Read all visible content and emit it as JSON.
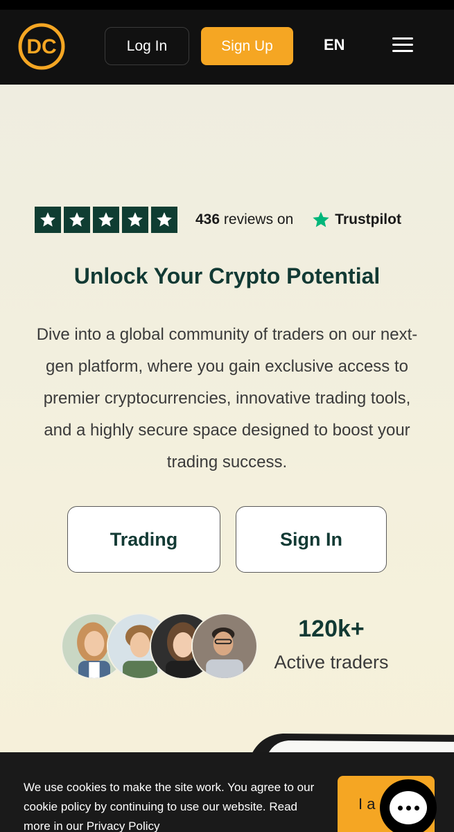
{
  "header": {
    "logo_text": "DC",
    "login_label": "Log In",
    "signup_label": "Sign Up",
    "language": "EN",
    "menu_icon": "hamburger-icon"
  },
  "trust": {
    "rating_stars": 5,
    "reviews_count": "436",
    "reviews_suffix": "reviews on",
    "provider": "Trustpilot"
  },
  "hero": {
    "headline": "Unlock Your Crypto Potential",
    "description": "Dive into a global community of traders on our next-gen platform, where you gain exclusive access to premier cryptocurrencies, innovative trading tools, and a highly secure space designed to boost your trading success.",
    "trading_button": "Trading",
    "signin_button": "Sign In"
  },
  "stats": {
    "active_count": "120k+",
    "active_label": "Active traders",
    "avatars": [
      "avatar-woman-blonde",
      "avatar-man-curly",
      "avatar-woman-dark",
      "avatar-man-glasses"
    ]
  },
  "cookie": {
    "text": "We use cookies to make the site work. You agree to our cookie policy by continuing to use our website. Read more in our Privacy Policy",
    "accept_label": "I a"
  },
  "colors": {
    "header_bg": "#111111",
    "accent": "#f5a623",
    "trust_green": "#0f3d32",
    "trustpilot_star": "#00b67a",
    "headline": "#123a34",
    "page_bg": "#f3f0e2"
  }
}
